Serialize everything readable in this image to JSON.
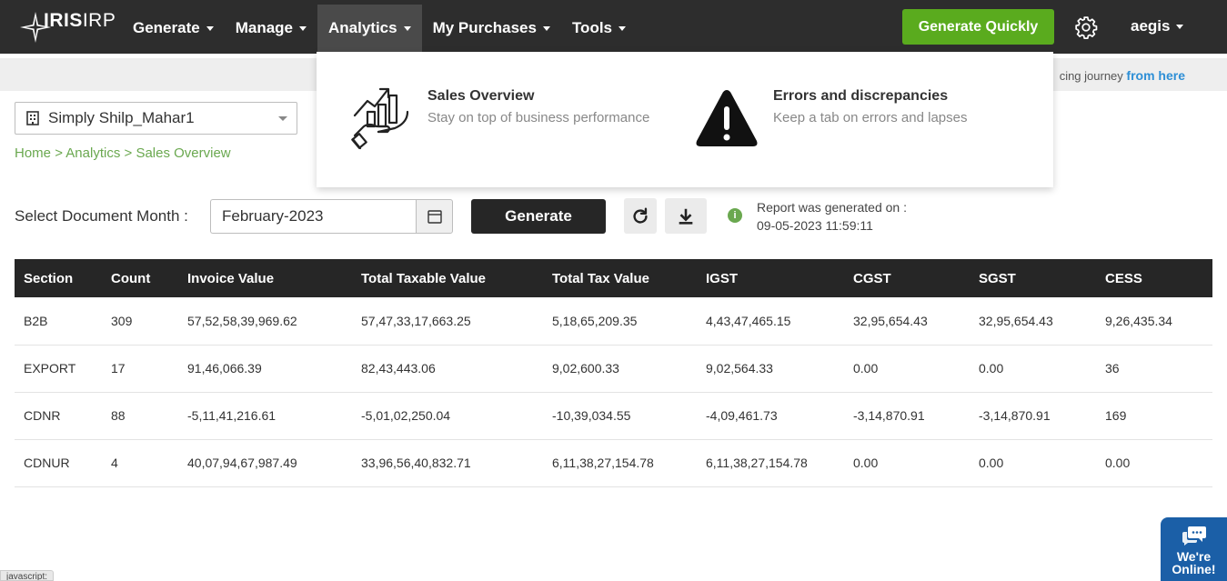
{
  "app": {
    "logo_text": "IRIS",
    "logo_suffix": "IRP"
  },
  "nav": {
    "items": [
      {
        "label": "Generate"
      },
      {
        "label": "Manage"
      },
      {
        "label": "Analytics"
      },
      {
        "label": "My Purchases"
      },
      {
        "label": "Tools"
      }
    ],
    "active": "Analytics",
    "generate_quickly": "Generate Quickly",
    "settings_icon": "gear-icon",
    "user": "aegis"
  },
  "banner": {
    "text": "cing journey",
    "link": "from here"
  },
  "analytics_menu": {
    "items": [
      {
        "title": "Sales Overview",
        "subtitle": "Stay on top of business performance",
        "icon": "growth-chart-hand-icon"
      },
      {
        "title": "Errors and discrepancies",
        "subtitle": "Keep a tab on errors and lapses",
        "icon": "warning-triangle-icon"
      }
    ]
  },
  "org": {
    "name": "Simply Shilp_Mahar1",
    "icon": "building-icon"
  },
  "breadcrumb": {
    "home": "Home",
    "analytics": "Analytics",
    "current": "Sales Overview",
    "sep": ">"
  },
  "filters": {
    "label": "Select Document Month :",
    "month": "February-2023",
    "generate_label": "Generate",
    "report_label": "Report was generated on :",
    "report_time": "09-05-2023 11:59:11"
  },
  "table": {
    "headers": [
      "Section",
      "Count",
      "Invoice Value",
      "Total Taxable Value",
      "Total Tax Value",
      "IGST",
      "CGST",
      "SGST",
      "CESS"
    ],
    "rows": [
      [
        "B2B",
        "309",
        "57,52,58,39,969.62",
        "57,47,33,17,663.25",
        "5,18,65,209.35",
        "4,43,47,465.15",
        "32,95,654.43",
        "32,95,654.43",
        "9,26,435.34"
      ],
      [
        "EXPORT",
        "17",
        "91,46,066.39",
        "82,43,443.06",
        "9,02,600.33",
        "9,02,564.33",
        "0.00",
        "0.00",
        "36"
      ],
      [
        "CDNR",
        "88",
        "-5,11,41,216.61",
        "-5,01,02,250.04",
        "-10,39,034.55",
        "-4,09,461.73",
        "-3,14,870.91",
        "-3,14,870.91",
        "169"
      ],
      [
        "CDNUR",
        "4",
        "40,07,94,67,987.49",
        "33,96,56,40,832.71",
        "6,11,38,27,154.78",
        "6,11,38,27,154.78",
        "0.00",
        "0.00",
        "0.00"
      ]
    ]
  },
  "chat": {
    "line1": "We're",
    "line2": "Online!"
  },
  "status": {
    "text": "javascript:"
  },
  "colors": {
    "topbar": "#2d2d2d",
    "accent_green": "#5aab1e",
    "link_blue": "#2e8fd6",
    "table_header": "#262626",
    "chat_blue": "#1b5fa7"
  }
}
